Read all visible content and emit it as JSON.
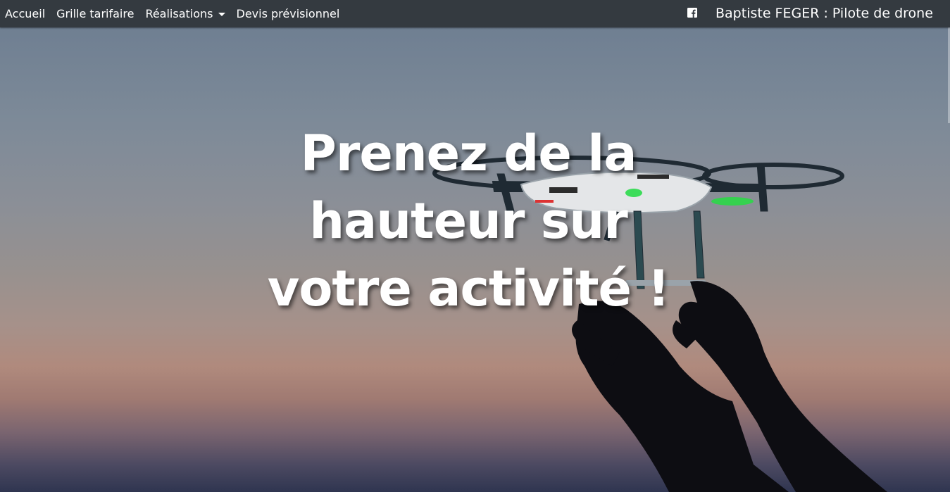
{
  "nav": {
    "items": [
      {
        "label": "Accueil"
      },
      {
        "label": "Grille tarifaire"
      },
      {
        "label": "Réalisations",
        "has_dropdown": true
      },
      {
        "label": "Devis prévisionnel"
      }
    ],
    "facebook_icon": "facebook-icon",
    "brand": "Baptiste FEGER : Pilote de drone",
    "background": "#343a40"
  },
  "hero": {
    "title_lines": [
      "Prenez de la",
      "hauteur sur",
      "votre activité !"
    ]
  }
}
